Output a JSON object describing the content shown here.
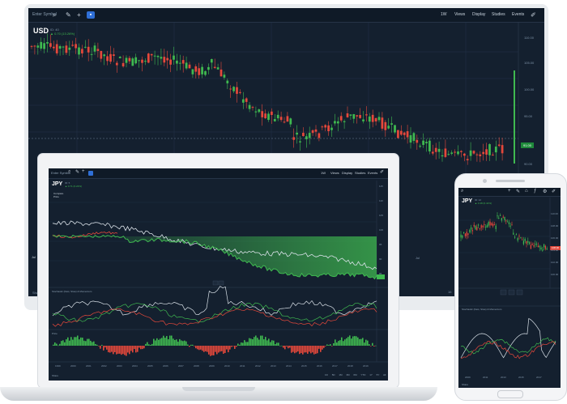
{
  "colors": {
    "background": "#14202f",
    "toolbar": "#0f1a27",
    "up": "#3fb950",
    "down": "#e5483b",
    "line": "#d9e1e8",
    "accent": "#2f6fd6"
  },
  "monitor": {
    "search_placeholder": "Enter Symbol",
    "toolbar": {
      "interval": "1W",
      "views": "Views",
      "display": "Display",
      "studies": "Studies",
      "events": "Events"
    },
    "symbol": "USD",
    "quote_label": "ID: 40",
    "change": "▲ 0.70 (13.26%)",
    "y_axis": [
      "110.00",
      "105.00",
      "100.00",
      "95.00",
      "90.00"
    ],
    "x_axis": [
      "Jul",
      "16"
    ],
    "price_tag": "91.00",
    "footer_left": "Share"
  },
  "laptop": {
    "search_placeholder": "Enter Symbol",
    "toolbar": {
      "interval": "1W",
      "views": "Views",
      "display": "Display",
      "studies": "Studies",
      "events": "Events"
    },
    "symbol": "JPY",
    "quote_label": "ID: 5",
    "change": "▲ 0.71 (0.22%)",
    "legend": [
      "Compare",
      "Price"
    ],
    "panel2_title": "Stochastic (Fast, Slow) & Momentum",
    "panel3_title": "Price",
    "y_axis": [
      "115",
      "110",
      "105",
      "100",
      "95",
      "90",
      "85"
    ],
    "x_axis": [
      "1999",
      "2000",
      "2001",
      "2002",
      "2003",
      "2004",
      "2005",
      "2006",
      "2007",
      "2008",
      "2009",
      "2010",
      "2011",
      "2012",
      "2013",
      "2014",
      "2015",
      "2016",
      "2017",
      "2018",
      "2019"
    ],
    "footer_left": "Share",
    "footer_ranges": [
      "1D",
      "5D",
      "1M",
      "3M",
      "6M",
      "YTD",
      "1Y",
      "5Y",
      "All"
    ]
  },
  "phone": {
    "symbol": "JPY",
    "quote_label": "ID: 12",
    "change": "▲ 0.48 (0.41%)",
    "y_axis": [
      "110.00",
      "108.00",
      "106.00",
      "104.00",
      "102.00",
      "100.00"
    ],
    "price_tag": "108.00",
    "panel_title": "Stochastic (Fast, Slow) & Momentum",
    "x_axis": [
      "2009",
      "2011",
      "2013",
      "2015",
      "2017"
    ],
    "footer_left": "Share"
  }
}
